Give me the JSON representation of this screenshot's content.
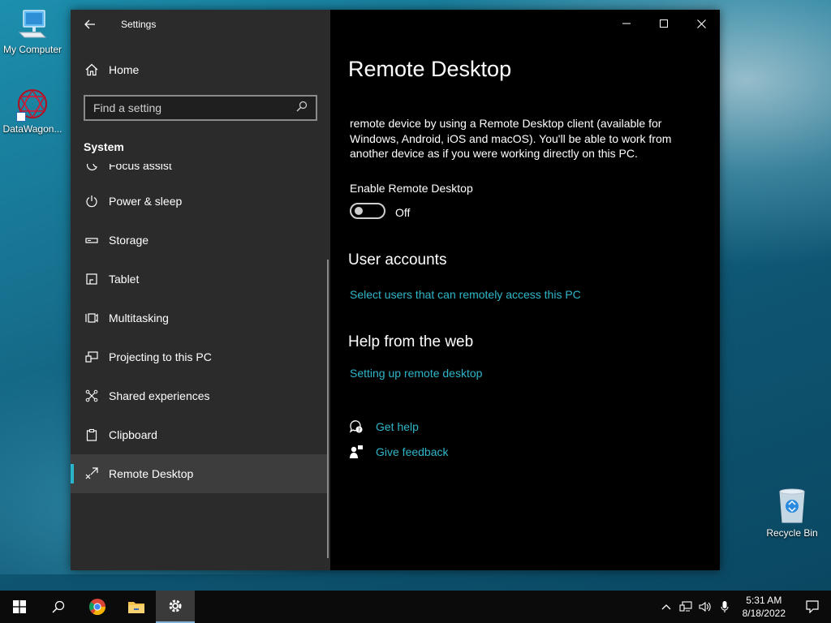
{
  "desktop": {
    "icons": [
      {
        "label": "My Computer"
      },
      {
        "label": "DataWagon..."
      },
      {
        "label": "Recycle Bin"
      }
    ]
  },
  "window": {
    "title": "Settings",
    "home_label": "Home",
    "search_placeholder": "Find a setting",
    "section": "System",
    "nav_items": [
      {
        "label": "Focus assist",
        "icon": "moon-icon"
      },
      {
        "label": "Power & sleep",
        "icon": "power-icon"
      },
      {
        "label": "Storage",
        "icon": "storage-icon"
      },
      {
        "label": "Tablet",
        "icon": "tablet-icon"
      },
      {
        "label": "Multitasking",
        "icon": "multitasking-icon"
      },
      {
        "label": "Projecting to this PC",
        "icon": "projecting-icon"
      },
      {
        "label": "Shared experiences",
        "icon": "shared-experiences-icon"
      },
      {
        "label": "Clipboard",
        "icon": "clipboard-icon"
      },
      {
        "label": "Remote Desktop",
        "icon": "remote-desktop-icon",
        "selected": true
      }
    ]
  },
  "content": {
    "title": "Remote Desktop",
    "description": "remote device by using a Remote Desktop client (available for Windows, Android, iOS and macOS). You'll be able to work from another device as if you were working directly on this PC.",
    "enable_label": "Enable Remote Desktop",
    "toggle_state": "Off",
    "user_accounts_heading": "User accounts",
    "user_accounts_link": "Select users that can remotely access this PC",
    "help_heading": "Help from the web",
    "help_link": "Setting up remote desktop",
    "get_help": "Get help",
    "give_feedback": "Give feedback"
  },
  "taskbar": {
    "time": "5:31 AM",
    "date": "8/18/2022"
  },
  "colors": {
    "accent": "#2bb5c8",
    "link": "#2fb6c9",
    "sidebar_bg": "#2b2b2b",
    "content_bg": "#000000"
  }
}
